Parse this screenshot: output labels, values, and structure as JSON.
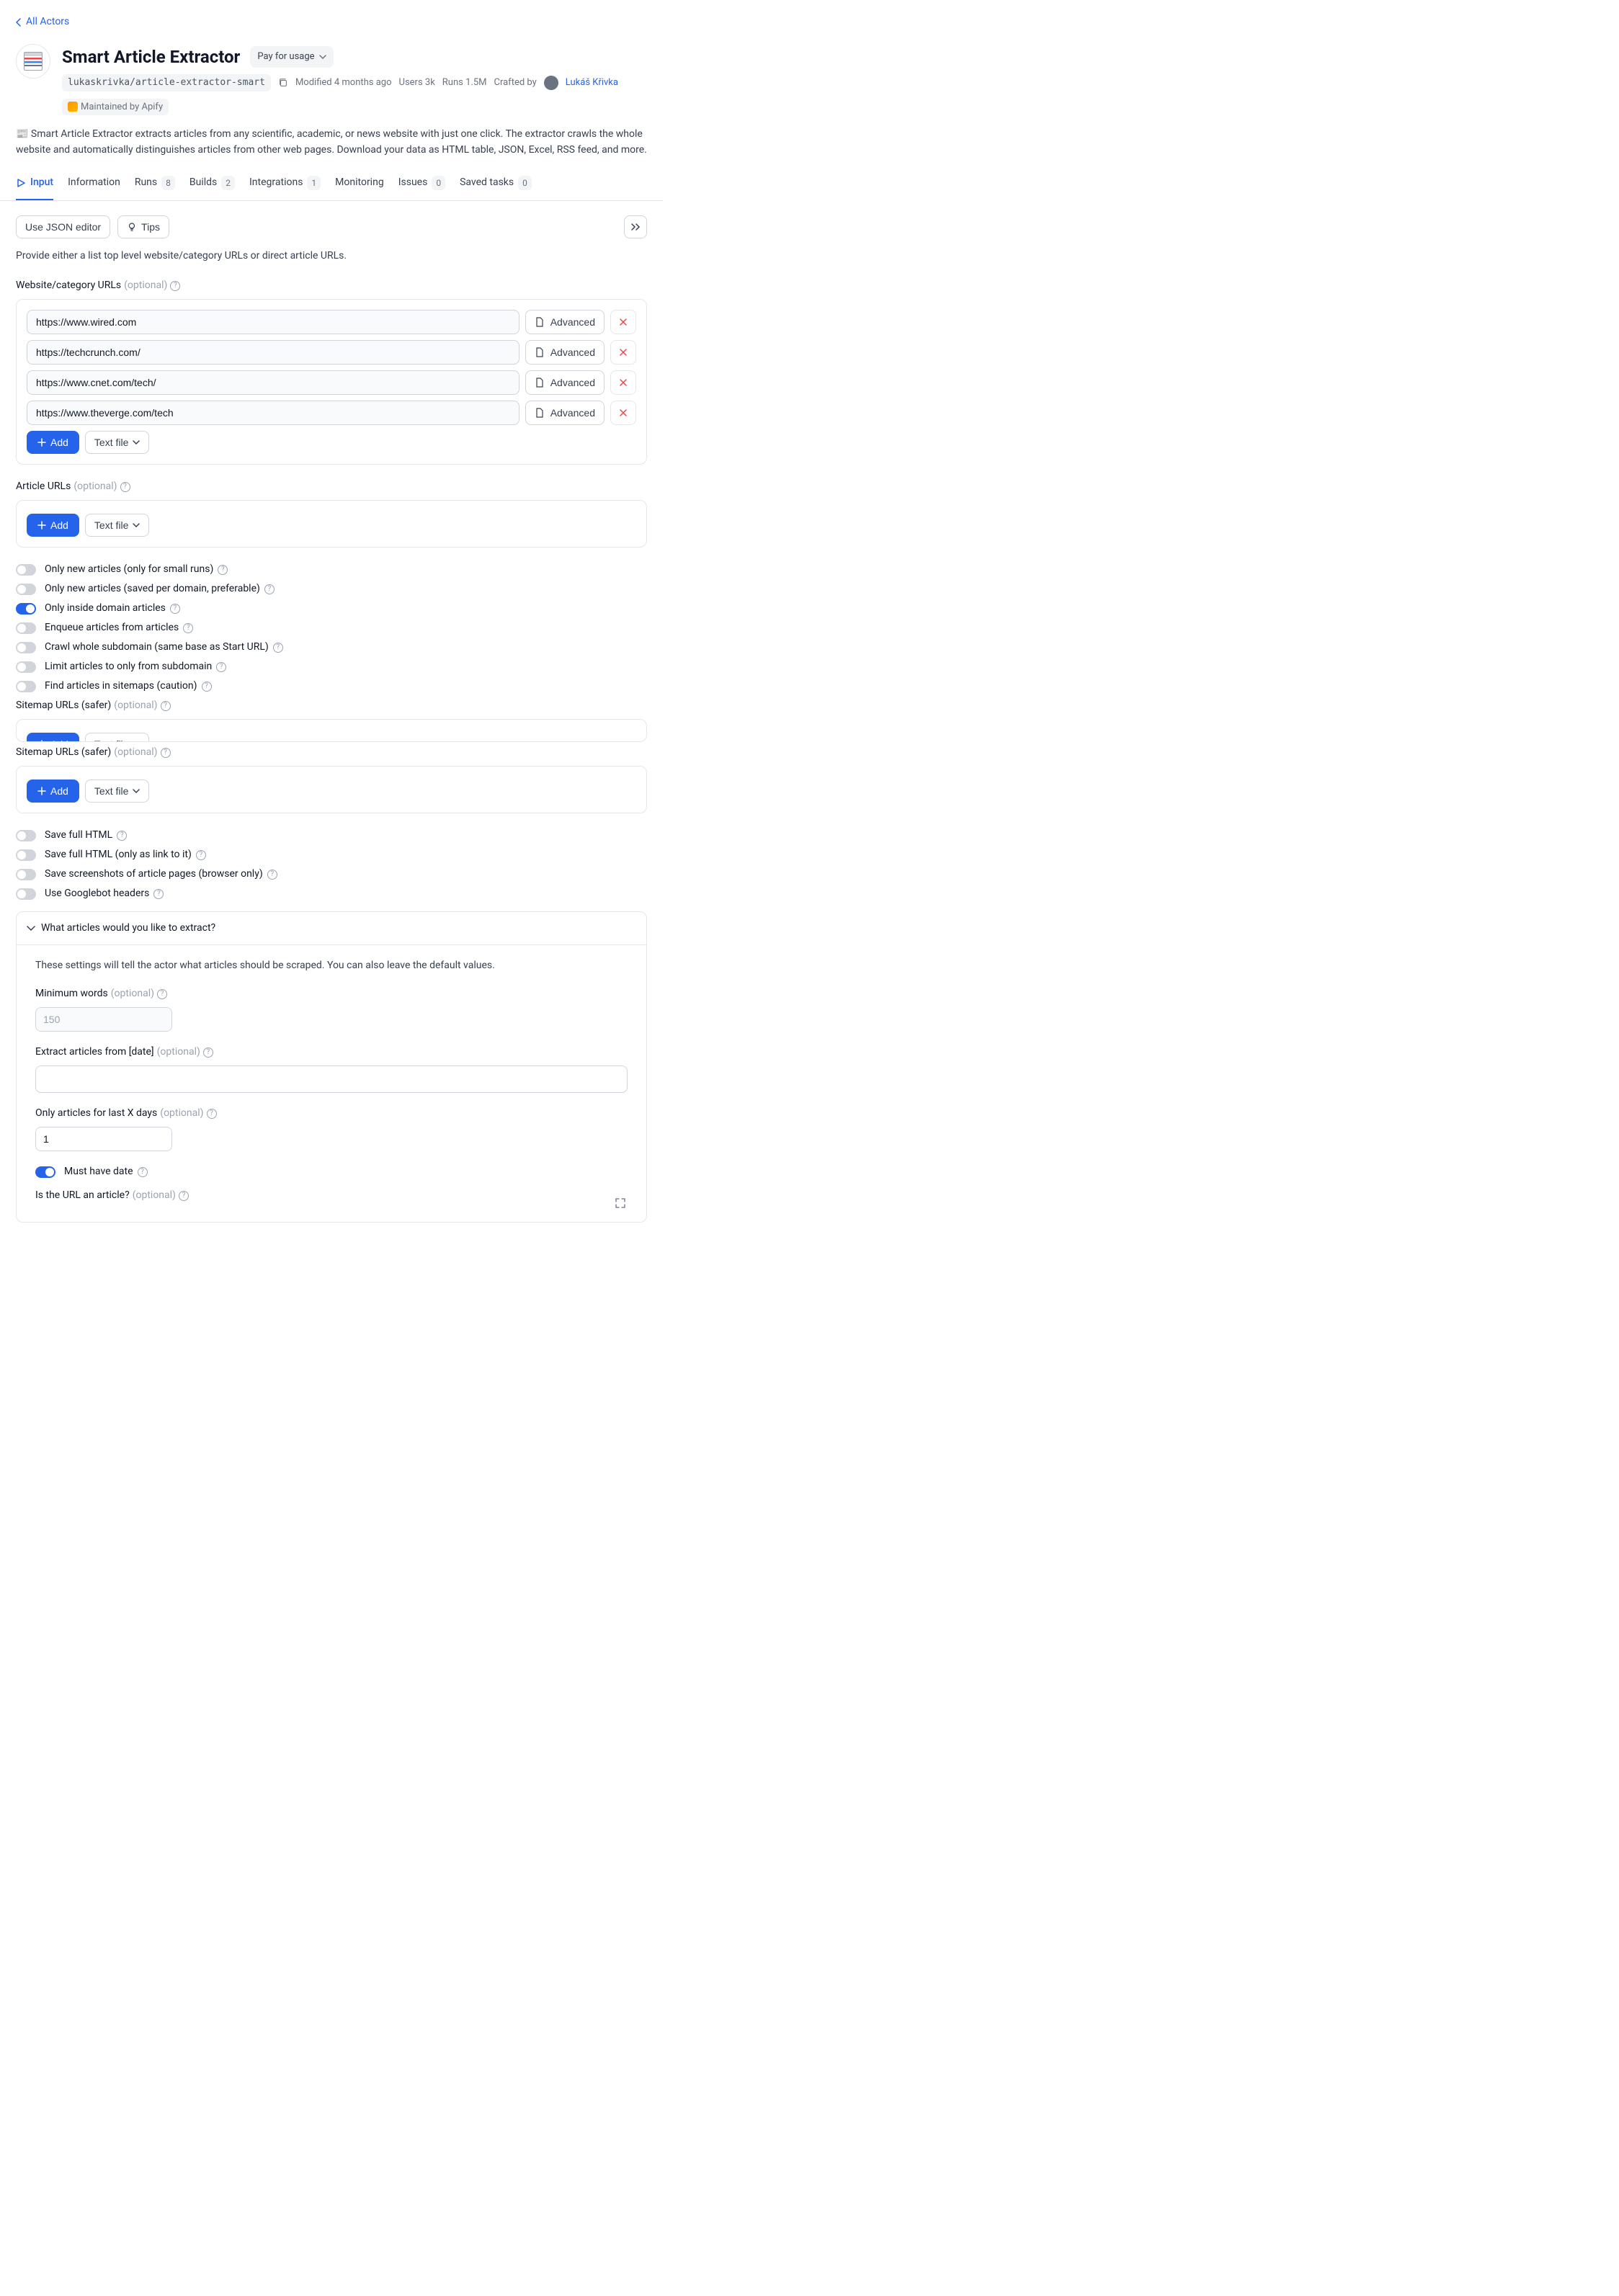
{
  "nav": {
    "back": "All Actors"
  },
  "header": {
    "title": "Smart Article Extractor",
    "pricing_badge": "Pay for usage",
    "slug": "lukaskrivka/article-extractor-smart",
    "modified": "Modified 4 months ago",
    "users": "Users 3k",
    "runs": "Runs 1.5M",
    "crafted_by_label": "Crafted by",
    "author": "Lukáš Křivka",
    "maintained": "Maintained by Apify"
  },
  "description": "📰 Smart Article Extractor extracts articles from any scientific, academic, or news website with just one click. The extractor crawls the whole website and automatically distinguishes articles from other web pages. Download your data as HTML table, JSON, Excel, RSS feed, and more.",
  "tabs": {
    "input": "Input",
    "information": "Information",
    "runs": "Runs",
    "runs_badge": "8",
    "builds": "Builds",
    "builds_badge": "2",
    "integrations": "Integrations",
    "integrations_badge": "1",
    "monitoring": "Monitoring",
    "issues": "Issues",
    "issues_badge": "0",
    "saved_tasks": "Saved tasks",
    "saved_tasks_badge": "0"
  },
  "toolbar": {
    "json_editor": "Use JSON editor",
    "tips": "Tips"
  },
  "help_text": "Provide either a list top level website/category URLs or direct article URLs.",
  "fields": {
    "website_urls": {
      "label": "Website/category URLs",
      "optional": "(optional)"
    },
    "article_urls": {
      "label": "Article URLs",
      "optional": "(optional)"
    },
    "sitemap_urls": {
      "label": "Sitemap URLs (safer)",
      "optional": "(optional)"
    }
  },
  "urls": [
    "https://www.wired.com",
    "https://techcrunch.com/",
    "https://www.cnet.com/tech/",
    "https://www.theverge.com/tech"
  ],
  "buttons": {
    "advanced": "Advanced",
    "add": "Add",
    "text_file": "Text file"
  },
  "toggles": {
    "only_new_small": "Only new articles (only for small runs)",
    "only_new_domain": "Only new articles (saved per domain, preferable)",
    "only_inside_domain": "Only inside domain articles",
    "enqueue": "Enqueue articles from articles",
    "crawl_subdomain": "Crawl whole subdomain (same base as Start URL)",
    "limit_subdomain": "Limit articles to only from subdomain",
    "find_sitemaps": "Find articles in sitemaps (caution)",
    "save_html": "Save full HTML",
    "save_html_link": "Save full HTML (only as link to it)",
    "save_screenshots": "Save screenshots of article pages (browser only)",
    "googlebot": "Use Googlebot headers",
    "must_have_date": "Must have date"
  },
  "section": {
    "title": "What articles would you like to extract?",
    "desc": "These settings will tell the actor what articles should be scraped. You can also leave the default values.",
    "min_words_label": "Minimum words",
    "min_words_optional": "(optional)",
    "min_words_placeholder": "150",
    "extract_date_label": "Extract articles from [date]",
    "extract_date_optional": "(optional)",
    "last_x_days_label": "Only articles for last X days",
    "last_x_days_optional": "(optional)",
    "last_x_days_value": "1",
    "is_url_label": "Is the URL an article?",
    "is_url_optional": "(optional)"
  }
}
